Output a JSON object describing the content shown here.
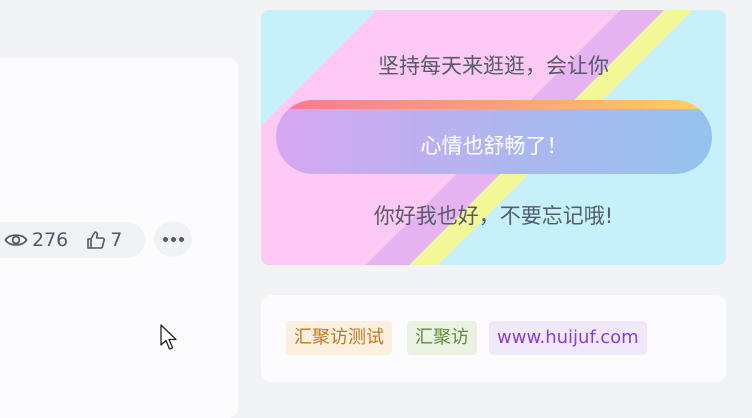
{
  "post": {
    "views": "276",
    "likes": "7"
  },
  "promo": {
    "line1": "坚持每天来逛逛，会让你",
    "highlight": "心情也舒畅了！",
    "line3": "你好我也好，不要忘记哦!"
  },
  "tags": [
    {
      "label": "汇聚访测试"
    },
    {
      "label": "汇聚访"
    },
    {
      "label": "www.huijuf.com"
    }
  ],
  "icons": {
    "views": "eye-icon",
    "likes": "thumbs-up-icon",
    "more": "more-horizontal-icon",
    "cursor": "mouse-pointer-icon"
  }
}
